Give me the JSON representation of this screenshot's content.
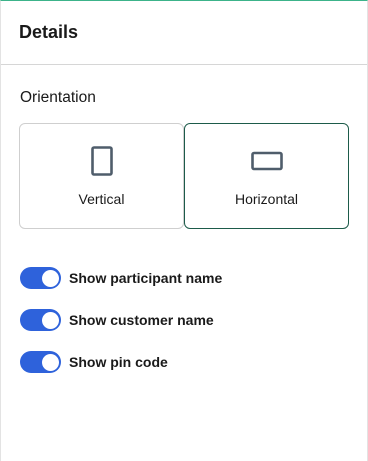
{
  "panel": {
    "title": "Details"
  },
  "orientation": {
    "label": "Orientation",
    "options": [
      {
        "label": "Vertical",
        "icon": "portrait-rectangle-icon",
        "selected": false
      },
      {
        "label": "Horizontal",
        "icon": "landscape-rectangle-icon",
        "selected": true
      }
    ]
  },
  "toggles": [
    {
      "label": "Show participant name",
      "on": true
    },
    {
      "label": "Show customer name",
      "on": true
    },
    {
      "label": "Show pin code",
      "on": true
    }
  ],
  "colors": {
    "accent_border": "#1d5b4a",
    "toggle_on": "#2e62db",
    "top_border": "#3cb38a"
  }
}
